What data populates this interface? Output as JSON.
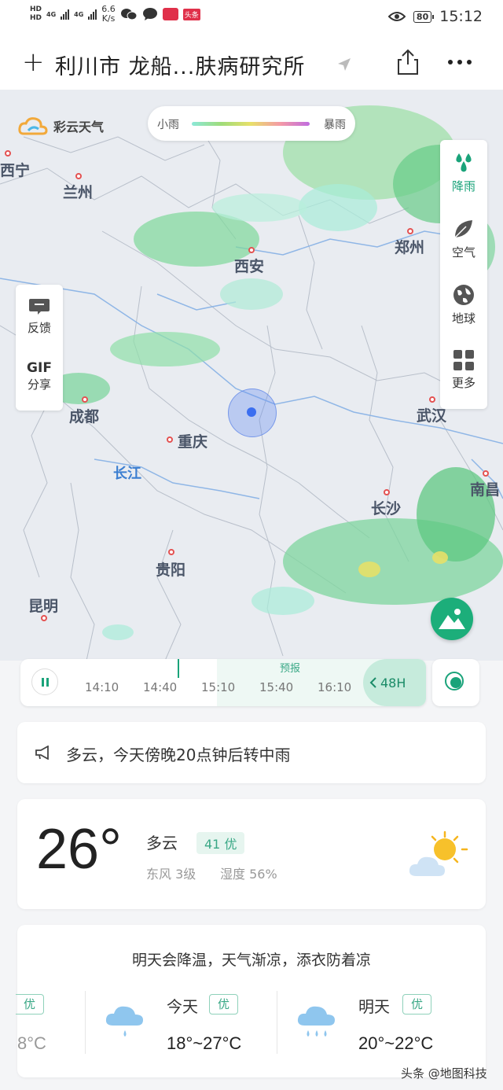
{
  "status_bar": {
    "hd1": "HD",
    "hd2": "HD",
    "net1": "4G",
    "net2": "4G",
    "speed": "6.6",
    "speed_unit": "K/s",
    "news_badge": "头条",
    "battery": "80",
    "time": "15:12"
  },
  "header": {
    "title": "利川市 龙船...肤病研究所"
  },
  "map": {
    "brand": "彩云天气",
    "legend_min": "小雨",
    "legend_max": "暴雨",
    "layers": [
      {
        "label": "降雨",
        "icon": "rain-drops-icon"
      },
      {
        "label": "空气",
        "icon": "leaf-icon"
      },
      {
        "label": "地球",
        "icon": "globe-icon"
      },
      {
        "label": "更多",
        "icon": "grid-icon"
      }
    ],
    "feedback_label": "反馈",
    "gif_label": "GIF",
    "share_label": "分享",
    "cities": [
      "西宁",
      "兰州",
      "郑州",
      "西安",
      "武汉",
      "成都",
      "重庆",
      "长沙",
      "南昌",
      "贵阳",
      "昆明"
    ],
    "river": "长江"
  },
  "timeline": {
    "forecast_label": "预报",
    "ticks": [
      "14:10",
      "14:40",
      "15:10",
      "15:40",
      "16:10"
    ],
    "range_button": "48H"
  },
  "notice": {
    "text": "多云，今天傍晚20点钟后转中雨"
  },
  "current": {
    "temperature": "26°",
    "condition": "多云",
    "aqi": "41 优",
    "wind": "东风 3级",
    "humidity": "湿度 56%"
  },
  "forecast": {
    "tip": "明天会降温，天气渐凉，添衣防着凉",
    "prev_badge": "优",
    "prev_range": "8°C",
    "days": [
      {
        "label": "今天",
        "badge": "优",
        "range": "18°~27°C"
      },
      {
        "label": "明天",
        "badge": "优",
        "range": "20°~22°C"
      }
    ]
  },
  "watermark": "头条 @地图科技",
  "colors": {
    "accent": "#1aa37a",
    "map_bg": "#e9ecf1",
    "city_dot": "#e45252",
    "river": "#3b7ed1"
  }
}
